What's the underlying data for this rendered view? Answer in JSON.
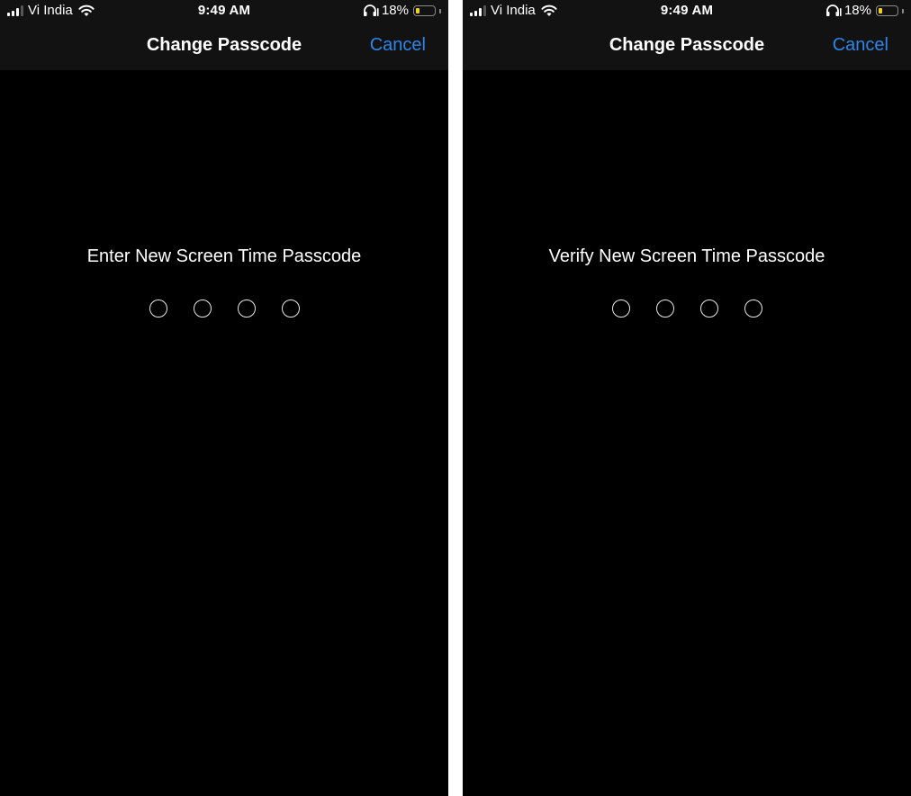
{
  "screens": [
    {
      "status_bar": {
        "carrier": "Vi India",
        "signal_bars": 4,
        "signal_bars_active": 3,
        "time": "9:49 AM",
        "battery_percent": "18%",
        "battery_level": 0.18,
        "icons": [
          "signal-icon",
          "wifi-icon",
          "headphones-icon",
          "battery-icon"
        ]
      },
      "nav": {
        "title": "Change Passcode",
        "cancel_label": "Cancel"
      },
      "prompt": "Enter New Screen Time Passcode",
      "passcode_length": 4,
      "digits_entered": 0
    },
    {
      "status_bar": {
        "carrier": "Vi India",
        "signal_bars": 4,
        "signal_bars_active": 3,
        "time": "9:49 AM",
        "battery_percent": "18%",
        "battery_level": 0.18,
        "icons": [
          "signal-icon",
          "wifi-icon",
          "headphones-icon",
          "battery-icon"
        ]
      },
      "nav": {
        "title": "Change Passcode",
        "cancel_label": "Cancel"
      },
      "prompt": "Verify New Screen Time Passcode",
      "passcode_length": 4,
      "digits_entered": 0
    }
  ],
  "colors": {
    "background": "#000000",
    "navbar": "#121212",
    "accent": "#2e86e8",
    "battery_fill": "#f4d21a",
    "divider": "#ffffff"
  }
}
